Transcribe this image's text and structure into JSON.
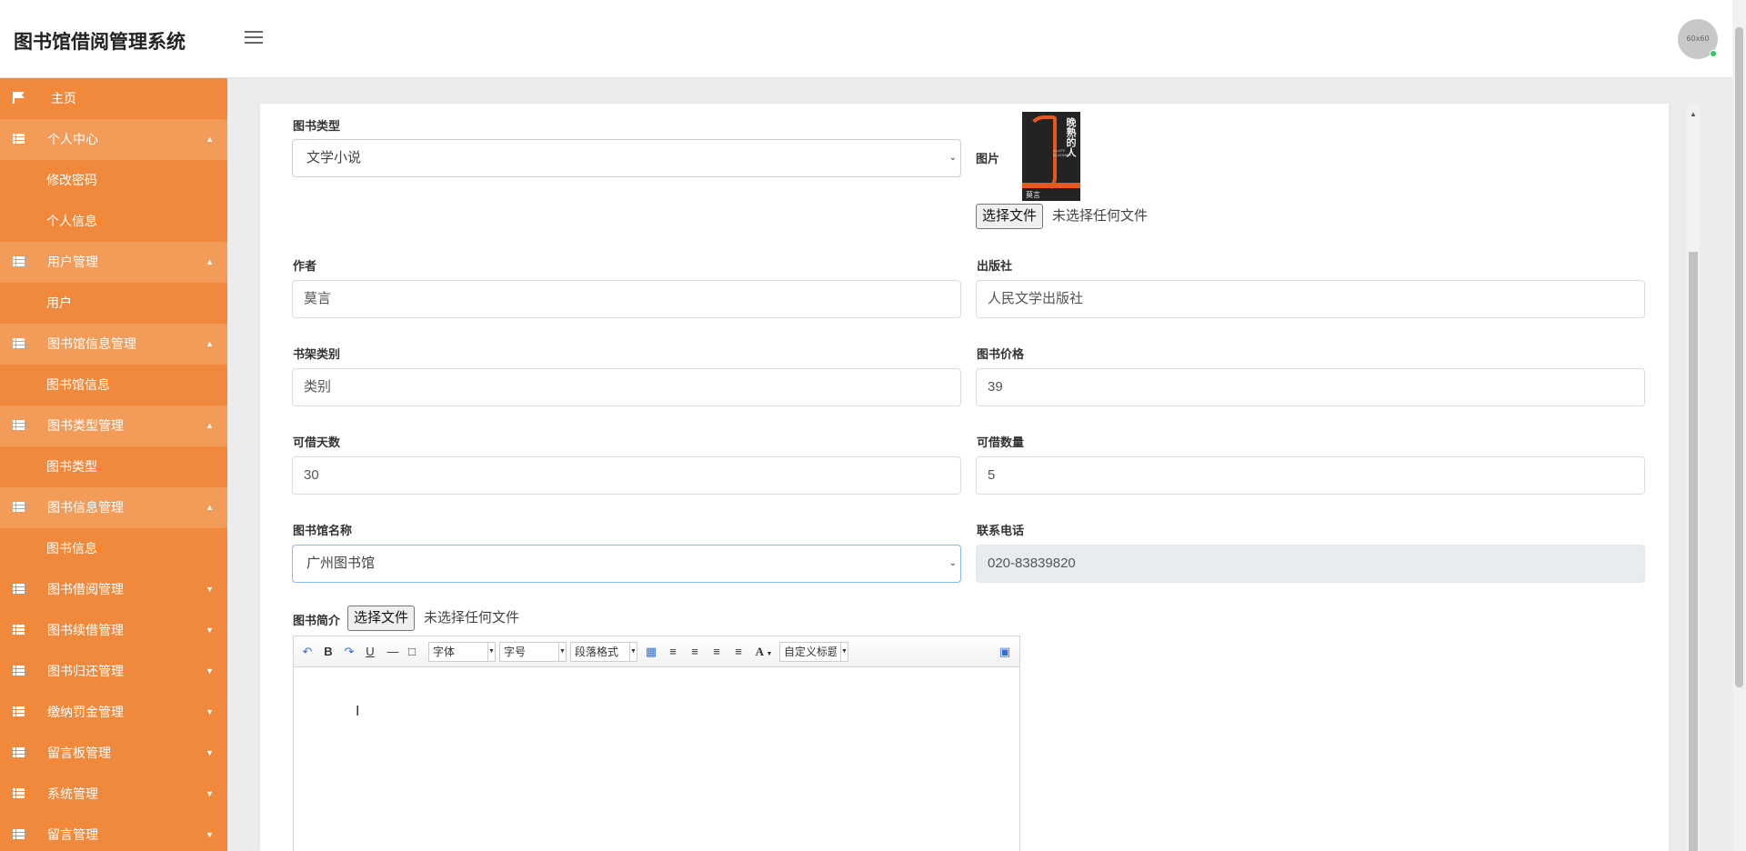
{
  "header": {
    "title": "图书馆借阅管理系统",
    "avatar_text": "60x60"
  },
  "sidebar": {
    "items": [
      {
        "label": "主页",
        "icon": "flag-icon",
        "type": "home"
      },
      {
        "label": "个人中心",
        "icon": "grid-icon",
        "type": "group",
        "caret": "▲"
      },
      {
        "label": "修改密码",
        "type": "sub"
      },
      {
        "label": "个人信息",
        "type": "sub"
      },
      {
        "label": "用户管理",
        "icon": "grid-icon",
        "type": "group",
        "caret": "▲"
      },
      {
        "label": "用户",
        "type": "sub"
      },
      {
        "label": "图书馆信息管理",
        "icon": "grid-icon",
        "type": "group",
        "caret": "▲"
      },
      {
        "label": "图书馆信息",
        "type": "sub"
      },
      {
        "label": "图书类型管理",
        "icon": "grid-icon",
        "type": "group",
        "caret": "▲"
      },
      {
        "label": "图书类型",
        "type": "sub"
      },
      {
        "label": "图书信息管理",
        "icon": "grid-icon",
        "type": "group",
        "caret": "▲"
      },
      {
        "label": "图书信息",
        "type": "sub"
      },
      {
        "label": "图书借阅管理",
        "icon": "grid-icon",
        "type": "collapsed",
        "caret": "▼"
      },
      {
        "label": "图书续借管理",
        "icon": "grid-icon",
        "type": "collapsed",
        "caret": "▼"
      },
      {
        "label": "图书归还管理",
        "icon": "grid-icon",
        "type": "collapsed",
        "caret": "▼"
      },
      {
        "label": "缴纳罚金管理",
        "icon": "grid-icon",
        "type": "collapsed",
        "caret": "▼"
      },
      {
        "label": "留言板管理",
        "icon": "grid-icon",
        "type": "collapsed",
        "caret": "▼"
      },
      {
        "label": "系统管理",
        "icon": "grid-icon",
        "type": "collapsed",
        "caret": "▼"
      },
      {
        "label": "留言管理",
        "icon": "grid-icon",
        "type": "collapsed",
        "caret": "▼"
      }
    ]
  },
  "form": {
    "book_type": {
      "label": "图书类型",
      "value": "文学小说"
    },
    "image": {
      "label": "图片",
      "button": "选择文件",
      "status": "未选择任何文件",
      "cover_title": "晚熟的人",
      "cover_author": "莫言"
    },
    "author": {
      "label": "作者",
      "value": "莫言"
    },
    "publisher": {
      "label": "出版社",
      "value": "人民文学出版社"
    },
    "shelf": {
      "label": "书架类别",
      "value": "类别"
    },
    "price": {
      "label": "图书价格",
      "value": "39"
    },
    "days": {
      "label": "可借天数",
      "value": "30"
    },
    "quantity": {
      "label": "可借数量",
      "value": "5"
    },
    "library": {
      "label": "图书馆名称",
      "value": "广州图书馆"
    },
    "phone": {
      "label": "联系电话",
      "value": "020-83839820"
    },
    "intro": {
      "label": "图书简介",
      "button": "选择文件",
      "status": "未选择任何文件"
    }
  },
  "editor": {
    "font_family": "字体",
    "font_size": "字号",
    "paragraph": "段落格式",
    "custom_title": "自定义标题",
    "font_color_glyph": "A"
  }
}
